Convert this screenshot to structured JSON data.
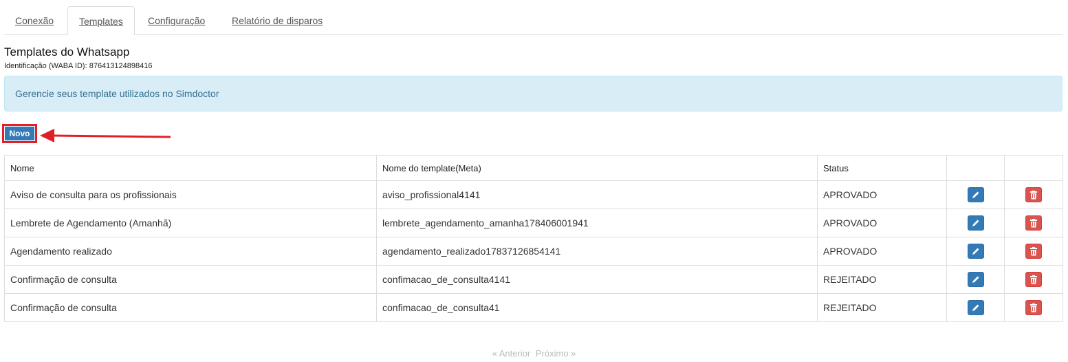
{
  "tabs": [
    {
      "label": "Conexão",
      "active": false
    },
    {
      "label": "Templates",
      "active": true
    },
    {
      "label": "Configuração",
      "active": false
    },
    {
      "label": "Relatório de disparos",
      "active": false
    }
  ],
  "page": {
    "title": "Templates do Whatsapp",
    "waba_label": "Identificação (WABA ID):",
    "waba_id": "876413124898416",
    "info": "Gerencie seus template utilizados no Simdoctor"
  },
  "toolbar": {
    "new_label": "Novo"
  },
  "annotation": {
    "arrow_color": "#e01f26"
  },
  "table": {
    "headers": [
      "Nome",
      "Nome do template(Meta)",
      "Status",
      "",
      ""
    ],
    "rows": [
      {
        "nome": "Aviso de consulta para os profissionais",
        "template": "aviso_profissional4141",
        "status": "APROVADO"
      },
      {
        "nome": "Lembrete de Agendamento (Amanhã)",
        "template": "lembrete_agendamento_amanha178406001941",
        "status": "APROVADO"
      },
      {
        "nome": "Agendamento realizado",
        "template": "agendamento_realizado17837126854141",
        "status": "APROVADO"
      },
      {
        "nome": "Confirmação de consulta",
        "template": "confimacao_de_consulta4141",
        "status": "REJEITADO"
      },
      {
        "nome": "Confirmação de consulta",
        "template": "confimacao_de_consulta41",
        "status": "REJEITADO"
      }
    ]
  },
  "colors": {
    "approved": "#3c763d",
    "rejected": "#c9302c",
    "primary": "#337ab7",
    "danger": "#d9534f"
  },
  "pagination": {
    "prev": "« Anterior",
    "next": "Próximo »"
  }
}
